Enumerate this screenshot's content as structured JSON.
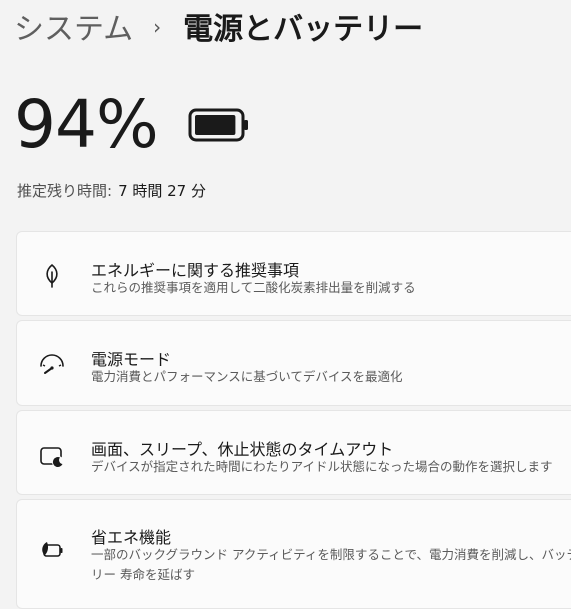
{
  "breadcrumb": {
    "parent": "システム",
    "separator": "›",
    "current": "電源とバッテリー"
  },
  "battery": {
    "percent_text": "94%",
    "level": 0.94,
    "remaining_label": "推定残り時間:",
    "remaining_value": "7 時間 27 分"
  },
  "settings": [
    {
      "icon": "leaf-icon",
      "title": "エネルギーに関する推奨事項",
      "description": "これらの推奨事項を適用して二酸化炭素排出量を削減する"
    },
    {
      "icon": "gauge-icon",
      "title": "電源モード",
      "description": "電力消費とパフォーマンスに基づいてデバイスを最適化"
    },
    {
      "icon": "screen-sleep-icon",
      "title": "画面、スリープ、休止状態のタイムアウト",
      "description": "デバイスが指定された時間にわたりアイドル状態になった場合の動作を選択します"
    },
    {
      "icon": "battery-saver-icon",
      "title": "省エネ機能",
      "description": "一部のバックグラウンド アクティビティを制限することで、電力消費を削減し、バッテリー 寿命を延ばす"
    }
  ],
  "colors": {
    "background": "#f3f3f3",
    "card": "#fbfbfb",
    "text": "#1a1a1a",
    "secondary_text": "#5a5a5a"
  }
}
